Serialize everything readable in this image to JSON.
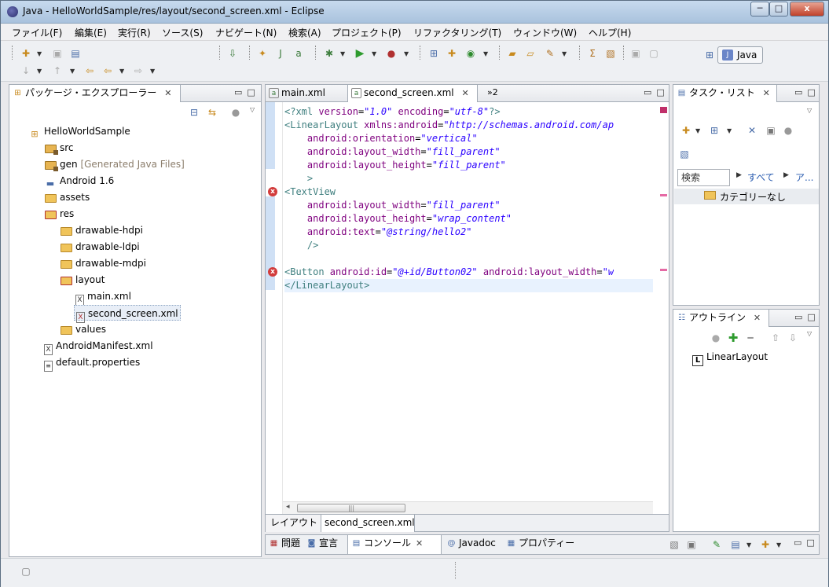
{
  "window": {
    "title": "Java - HelloWorldSample/res/layout/second_screen.xml - Eclipse",
    "controls": {
      "minimize": "─",
      "maximize": "□",
      "close": "x"
    }
  },
  "menu": [
    "ファイル(F)",
    "編集(E)",
    "実行(R)",
    "ソース(S)",
    "ナビゲート(N)",
    "検索(A)",
    "プロジェクト(P)",
    "リファクタリング(T)",
    "ウィンドウ(W)",
    "ヘルプ(H)"
  ],
  "perspective": {
    "label": "Java"
  },
  "package_explorer": {
    "title": "パッケージ・エクスプローラー",
    "items": [
      {
        "label": "HelloWorldSample",
        "decoration": ""
      },
      {
        "label": "src",
        "decoration": ""
      },
      {
        "label": "gen",
        "decoration": "[Generated Java Files]"
      },
      {
        "label": "Android 1.6",
        "decoration": ""
      },
      {
        "label": "assets",
        "decoration": ""
      },
      {
        "label": "res",
        "decoration": ""
      },
      {
        "label": "drawable-hdpi",
        "decoration": ""
      },
      {
        "label": "drawable-ldpi",
        "decoration": ""
      },
      {
        "label": "drawable-mdpi",
        "decoration": ""
      },
      {
        "label": "layout",
        "decoration": ""
      },
      {
        "label": "main.xml",
        "decoration": ""
      },
      {
        "label": "second_screen.xml",
        "decoration": ""
      },
      {
        "label": "values",
        "decoration": ""
      },
      {
        "label": "AndroidManifest.xml",
        "decoration": ""
      },
      {
        "label": "default.properties",
        "decoration": ""
      }
    ]
  },
  "editor": {
    "tabs": [
      {
        "label": "main.xml"
      },
      {
        "label": "second_screen.xml"
      }
    ],
    "overflow_label": "»2",
    "code_lines": [
      "<?xml version=\"1.0\" encoding=\"utf-8\"?>",
      "<LinearLayout xmlns:android=\"http://schemas.android.com/ap",
      "    android:orientation=\"vertical\"",
      "    android:layout_width=\"fill_parent\"",
      "    android:layout_height=\"fill_parent\"",
      "    >",
      "<TextView",
      "    android:layout_width=\"fill_parent\"",
      "    android:layout_height=\"wrap_content\"",
      "    android:text=\"@string/hello2\"",
      "    />",
      "",
      "<Button android:id=\"@+id/Button02\" android:layout_width=\"w",
      "</LinearLayout>"
    ],
    "bottom_tabs": [
      {
        "label": "レイアウト"
      },
      {
        "label": "second_screen.xml"
      }
    ],
    "scroll_grip": "|||"
  },
  "task_list": {
    "title": "タスク・リスト",
    "search_placeholder": "検索",
    "filter_all": "すべて",
    "filter_more": "ア...",
    "category": "カテゴリーなし"
  },
  "outline": {
    "title": "アウトライン",
    "items": [
      {
        "label": "LinearLayout",
        "icon_letter": "L"
      }
    ]
  },
  "bottom_views": [
    {
      "label": "問題"
    },
    {
      "label": "宣言"
    },
    {
      "label": "コンソール"
    },
    {
      "label": "Javadoc"
    },
    {
      "label": "プロパティー"
    }
  ],
  "colors": {
    "xml_tag": "#3f7f7f",
    "xml_attr": "#7f007f",
    "xml_value": "#2a00ff",
    "error": "#d23c3c"
  }
}
